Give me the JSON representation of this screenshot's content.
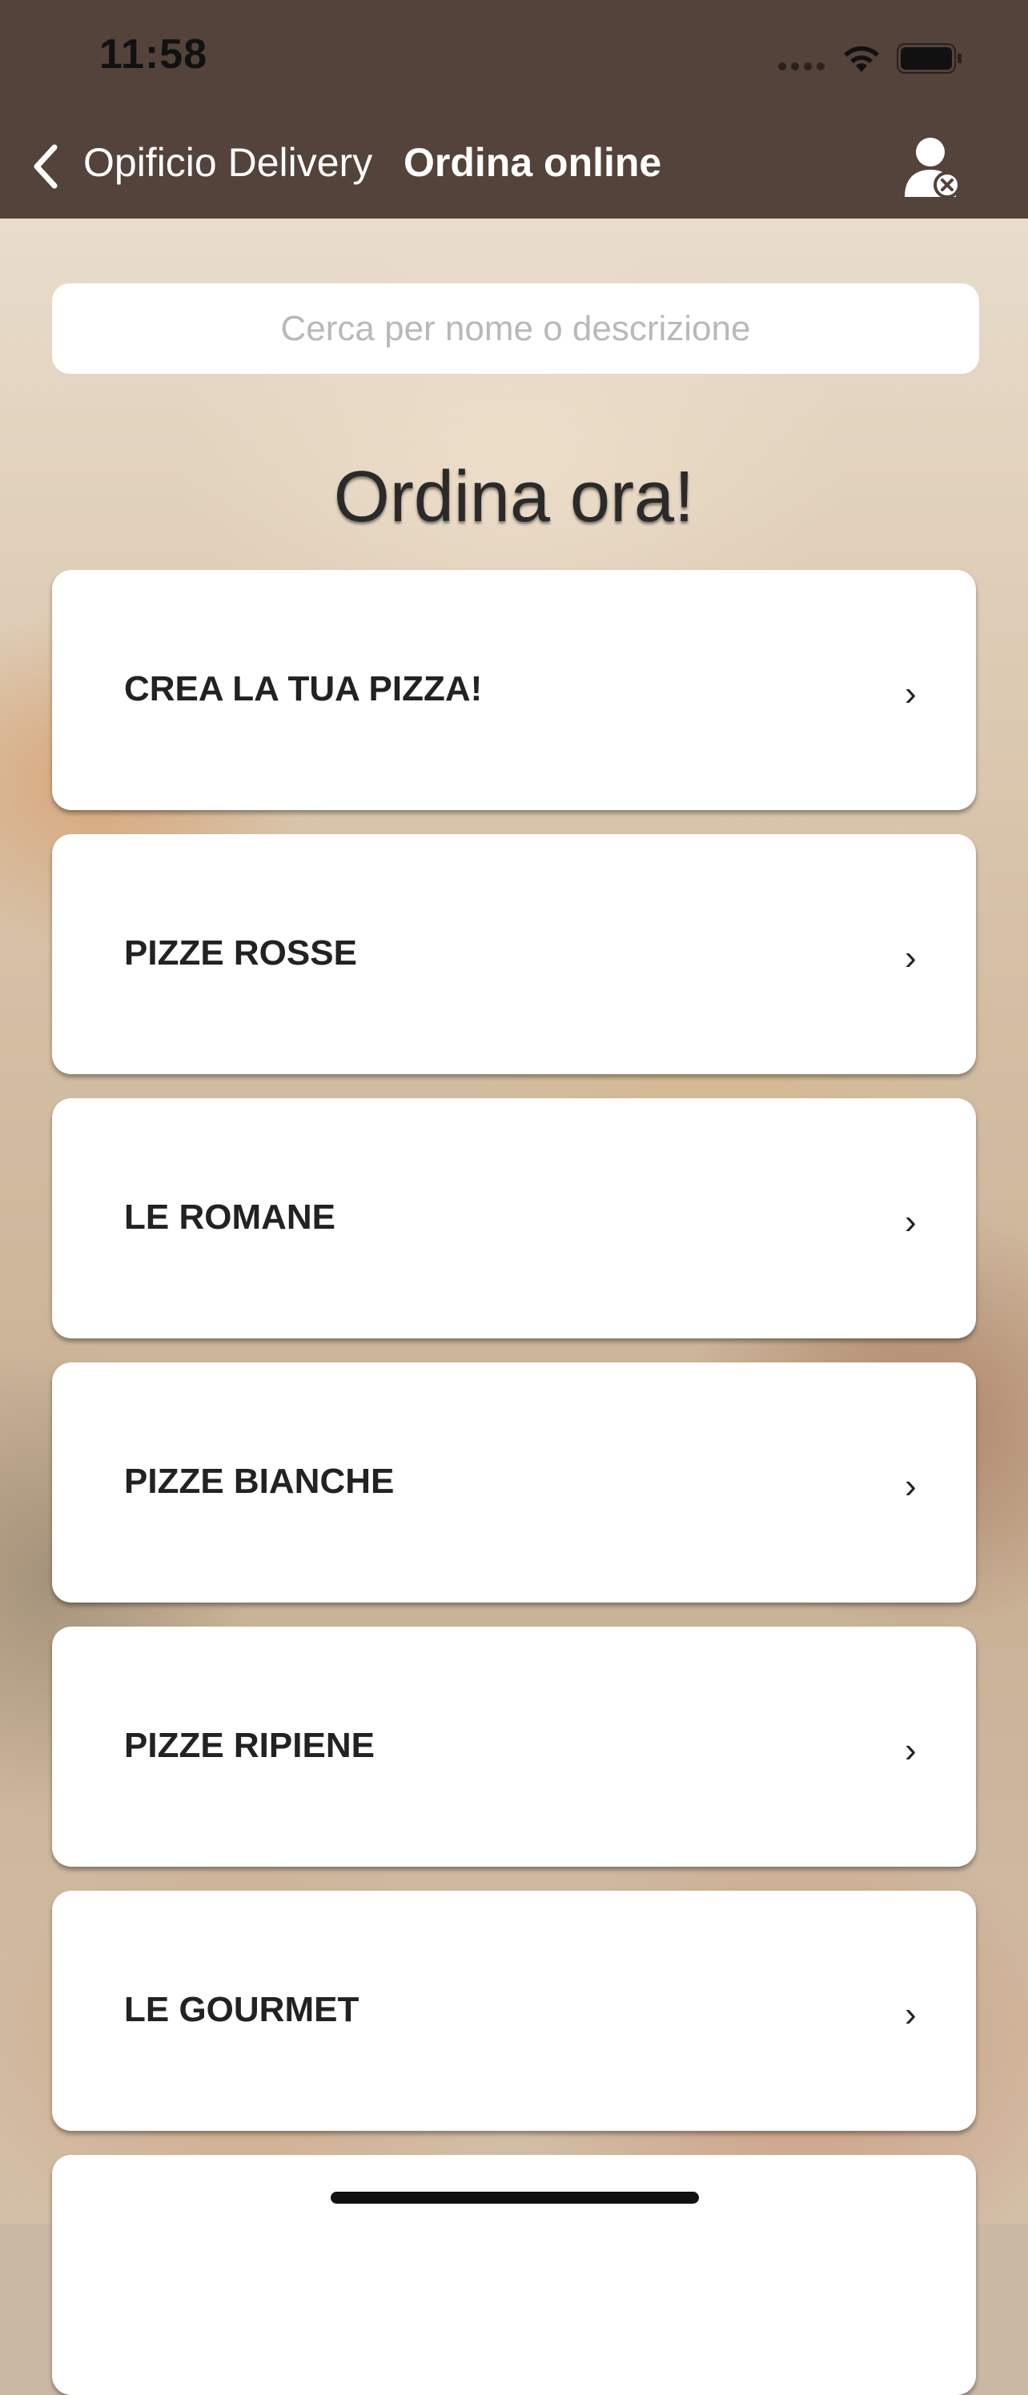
{
  "status_bar": {
    "time": "11:58"
  },
  "nav": {
    "back_label": "Opificio Delivery",
    "title": "Ordina online"
  },
  "search": {
    "placeholder": "Cerca per nome o descrizione"
  },
  "heading": "Ordina ora!",
  "categories": [
    {
      "label": "CREA LA TUA PIZZA!"
    },
    {
      "label": "PIZZE ROSSE"
    },
    {
      "label": "LE ROMANE"
    },
    {
      "label": "PIZZE BIANCHE"
    },
    {
      "label": "PIZZE RIPIENE"
    },
    {
      "label": "LE GOURMET"
    },
    {
      "label": ""
    }
  ],
  "chevron": "›"
}
